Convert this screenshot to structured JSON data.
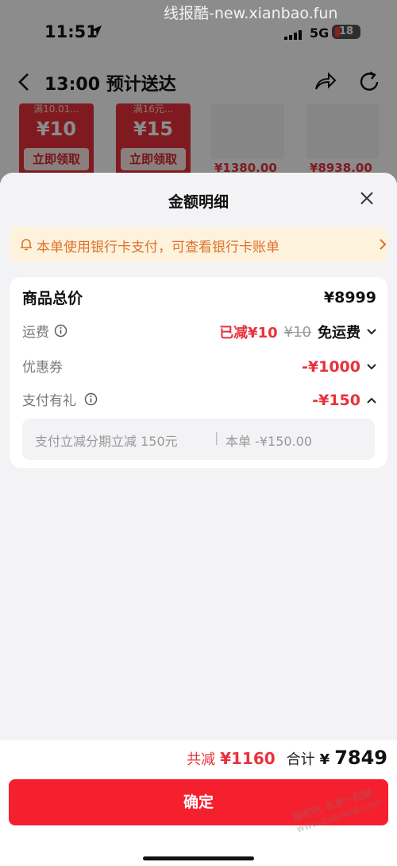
{
  "status_bar": {
    "time": "11:51",
    "network": "5G",
    "battery": "18",
    "watermark": "线报酷-new.xianbao.fun"
  },
  "nav": {
    "title": "13:00 预计送达"
  },
  "background_promos": {
    "coupons": [
      {
        "top": "满10.01...",
        "amount": "¥10",
        "button": "立即领取"
      },
      {
        "top": "满16元...",
        "amount": "¥15",
        "button": "立即领取"
      }
    ],
    "products": [
      {
        "price": "¥1380.00"
      },
      {
        "price": "¥8938.00"
      }
    ]
  },
  "sheet": {
    "title": "金额明细",
    "notice": "本单使用银行卡支付，可查看银行卡账单",
    "rows": {
      "total": {
        "label": "商品总价",
        "value": "¥8999"
      },
      "shipping": {
        "label": "运费",
        "discount": "已减¥10",
        "original": "¥10",
        "status": "免运费"
      },
      "coupon": {
        "label": "优惠券",
        "value": "-¥1000"
      },
      "gift": {
        "label": "支付有礼",
        "value": "-¥150"
      }
    },
    "gift_detail": {
      "desc": "支付立减分期立减 150元",
      "order": "本单 -¥150.00"
    }
  },
  "footer": {
    "saved_label": "共减",
    "saved_value": "¥1160",
    "sum_label": "合计",
    "sum_currency": "¥",
    "sum_value": "7849",
    "confirm": "确定",
    "watermark": "赚客吧, 有更一起赚 www.zuanke8.com"
  },
  "colors": {
    "accent_red": "#e8323b",
    "button_red": "#f5202e",
    "notice_bg": "#fdf3dd",
    "notice_text": "#e0712a"
  }
}
